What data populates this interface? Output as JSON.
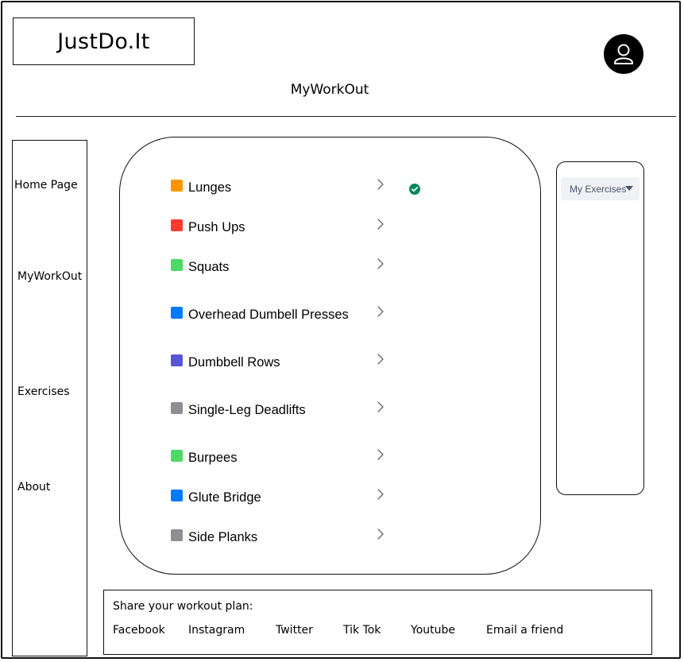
{
  "header": {
    "logo_text": "JustDo.It",
    "page_title": "MyWorkOut",
    "avatar_icon": "user-icon"
  },
  "sidebar": {
    "items": [
      {
        "label": "Home Page"
      },
      {
        "label": "MyWorkOut"
      },
      {
        "label": "Exercises"
      },
      {
        "label": "About"
      }
    ]
  },
  "exercises": [
    {
      "label": "Lunges",
      "color": "#FF9500",
      "completed": true
    },
    {
      "label": "Push Ups",
      "color": "#FF3B30",
      "completed": false
    },
    {
      "label": "Squats",
      "color": "#4CD964",
      "completed": false
    },
    {
      "label": "Overhead Dumbell Presses",
      "color": "#007AFF",
      "completed": false
    },
    {
      "label": "Dumbbell Rows",
      "color": "#5856D6",
      "completed": false
    },
    {
      "label": "Single-Leg Deadlifts",
      "color": "#8E8E93",
      "completed": false
    },
    {
      "label": "Burpees",
      "color": "#4CD964",
      "completed": false
    },
    {
      "label": "Glute Bridge",
      "color": "#007AFF",
      "completed": false
    },
    {
      "label": "Side Planks",
      "color": "#8E8E93",
      "completed": false
    }
  ],
  "completed_icon": "check-circle-icon",
  "completed_color": "#00875A",
  "right_panel": {
    "dropdown": {
      "selected": "My Exercises",
      "icon": "caret-down-icon"
    }
  },
  "share": {
    "title": "Share your workout plan:",
    "links": [
      {
        "label": "Facebook"
      },
      {
        "label": "Instagram"
      },
      {
        "label": "Twitter"
      },
      {
        "label": "Tik Tok"
      },
      {
        "label": "Youtube"
      },
      {
        "label": "Email a friend"
      }
    ]
  }
}
